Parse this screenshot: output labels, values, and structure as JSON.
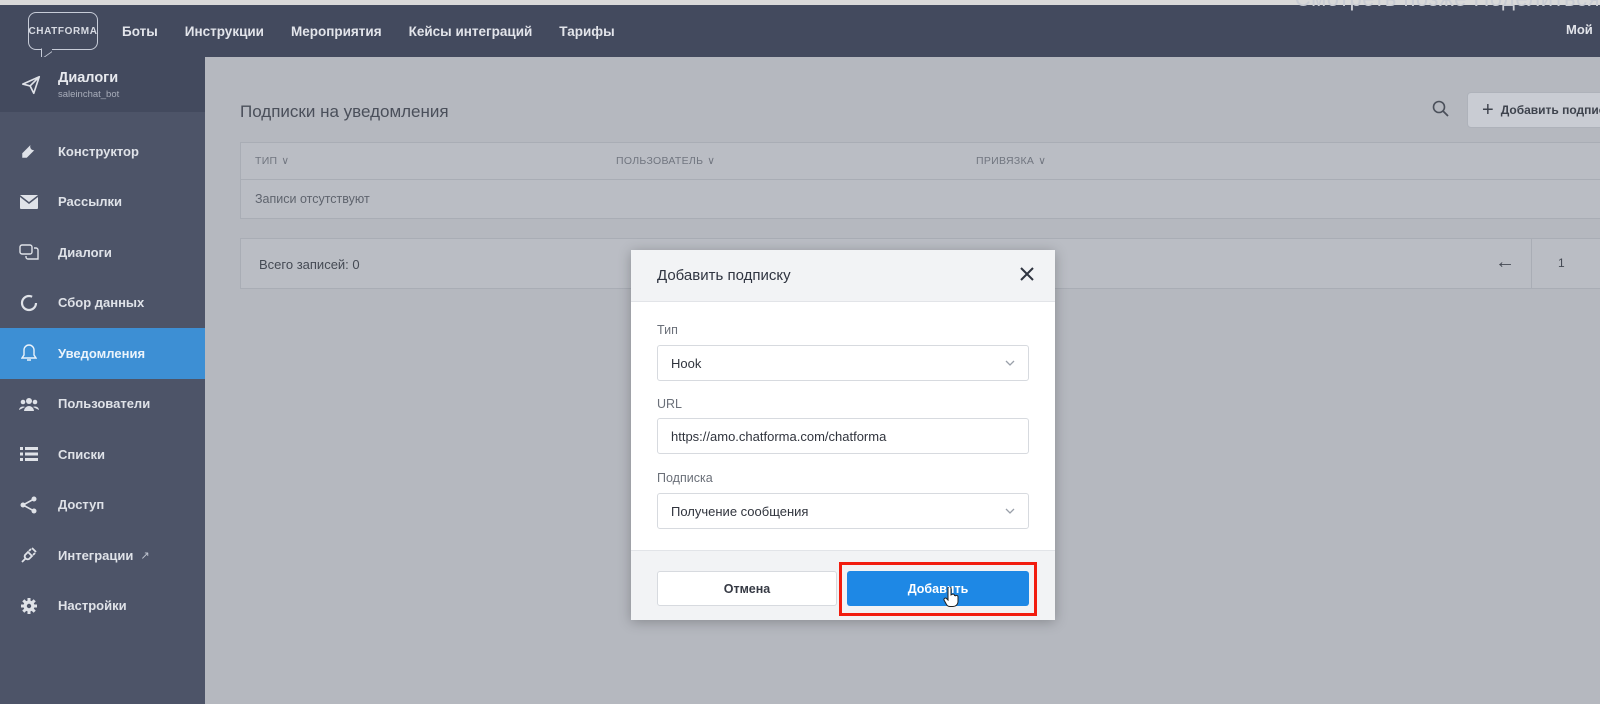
{
  "video_overlay": {
    "text": "Смотреть позже   Поделиться"
  },
  "header": {
    "logo": "CHATFORMA",
    "nav": [
      "Боты",
      "Инструкции",
      "Мероприятия",
      "Кейсы интеграций",
      "Тарифы"
    ],
    "right_label": "Мой"
  },
  "sidebar": {
    "bot_title": "Диалоги",
    "bot_sub": "saleinchat_bot",
    "items": [
      {
        "label": "Конструктор",
        "icon": "wrench-icon"
      },
      {
        "label": "Рассылки",
        "icon": "envelope-icon"
      },
      {
        "label": "Диалоги",
        "icon": "chat-icon"
      },
      {
        "label": "Сбор данных",
        "icon": "circle-chart-icon"
      },
      {
        "label": "Уведомления",
        "icon": "bell-icon",
        "active": true
      },
      {
        "label": "Пользователи",
        "icon": "users-icon"
      },
      {
        "label": "Списки",
        "icon": "list-icon"
      },
      {
        "label": "Доступ",
        "icon": "share-icon"
      },
      {
        "label": "Интеграции",
        "icon": "plug-icon",
        "external": true
      },
      {
        "label": "Настройки",
        "icon": "gear-icon"
      }
    ]
  },
  "main": {
    "title": "Подписки на уведомления",
    "add_button": "Добавить подписку",
    "columns": [
      "ТИП",
      "ПОЛЬЗОВАТЕЛЬ",
      "ПРИВЯЗКА"
    ],
    "empty_text": "Записи отсутствуют",
    "total": "Всего записей: 0",
    "page": "1"
  },
  "modal": {
    "title": "Добавить подписку",
    "type_label": "Тип",
    "type_value": "Hook",
    "url_label": "URL",
    "url_value": "https://amo.chatforma.com/chatforma",
    "subscription_label": "Подписка",
    "subscription_value": "Получение сообщения",
    "cancel": "Отмена",
    "submit": "Добавить"
  },
  "colors": {
    "accent": "#1e88e5",
    "highlight": "#f21d0f",
    "sidebar_active": "#3d8fd4"
  }
}
